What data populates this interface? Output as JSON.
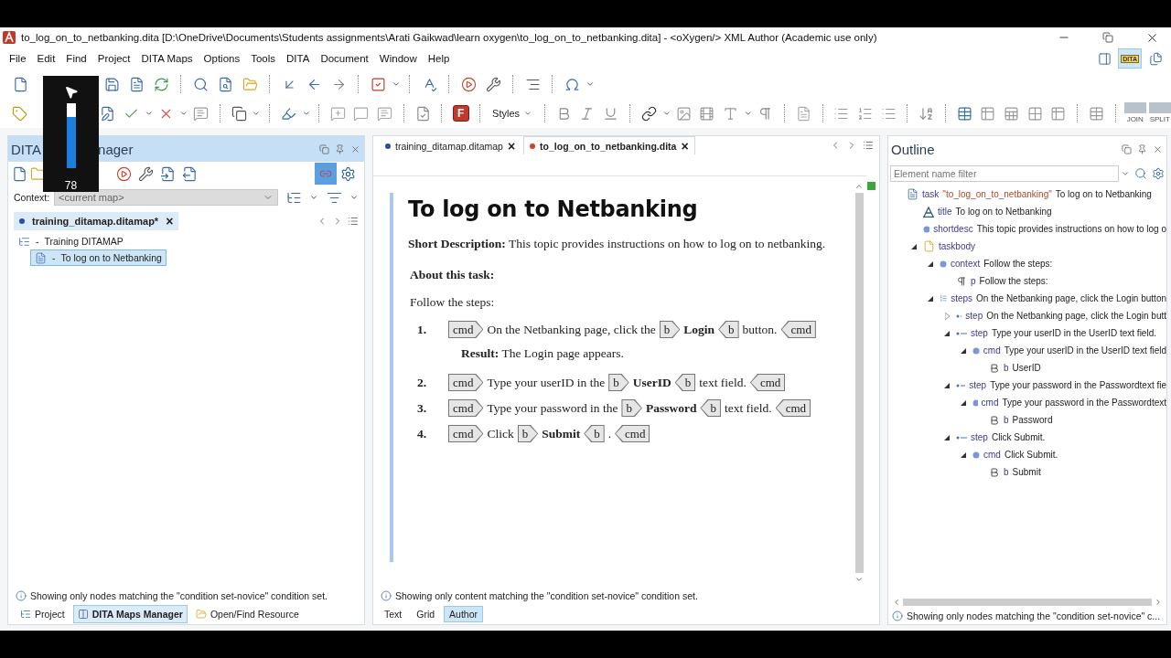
{
  "window": {
    "title": "to_log_on_to_netbanking.dita [D:\\OneDrive\\Documents\\Students assignments\\Arati Gaikwad\\learn oxygen\\to_log_on_to_netbanking.dita] - <oXygen/> XML Author (Academic use only)"
  },
  "menu": [
    "File",
    "Edit",
    "Find",
    "Project",
    "DITA Maps",
    "Options",
    "Tools",
    "DITA",
    "Document",
    "Window",
    "Help"
  ],
  "perspectives": [
    {
      "label": "DITA",
      "selected": true
    }
  ],
  "toolbar": {
    "styles": "Styles",
    "f_logo": "F",
    "table_tools": [
      "JOIN",
      "SPLIT"
    ]
  },
  "volume_overlay": {
    "reading": "78",
    "level": 0.78
  },
  "maps_manager": {
    "title_parts": [
      "DITA",
      "nager"
    ],
    "context_label": "Context:",
    "context_value": "<current map>",
    "tab": {
      "label": "training_ditamap.ditamap*",
      "close": "×"
    },
    "tree": [
      {
        "text": "Training DITAMAP",
        "dash": "-",
        "selected": false,
        "children": [
          {
            "text": "To log on to Netbanking",
            "dash": "-",
            "selected": true
          }
        ]
      }
    ],
    "info": "Showing only nodes matching the \"condition set-novice\" condition set."
  },
  "bottom_tabs": [
    {
      "label": "Project",
      "selected": false
    },
    {
      "label": "DITA Maps Manager",
      "selected": true
    },
    {
      "label": "Open/Find Resource",
      "selected": false
    }
  ],
  "editor": {
    "tabs": [
      {
        "label": "training_ditamap.ditamap",
        "close": "×",
        "selected": false,
        "color": "#2a4fa0"
      },
      {
        "label": "to_log_on_to_netbanking.dita",
        "close": "×",
        "selected": true,
        "color": "#d0402a"
      }
    ],
    "title": "To log on to Netbanking",
    "shortdesc": {
      "label": "Short Description:",
      "text": "This topic provides instructions on how to log on to netbanking."
    },
    "about": "About this task:",
    "context": "Follow the steps:",
    "steps": [
      {
        "number": "1.",
        "segments": [
          {
            "kind": "open",
            "text": "cmd"
          },
          {
            "kind": "text",
            "text": "On the Netbanking page, click the"
          },
          {
            "kind": "open",
            "text": "b"
          },
          {
            "kind": "bold",
            "text": "Login"
          },
          {
            "kind": "close",
            "text": "b"
          },
          {
            "kind": "text",
            "text": "button."
          },
          {
            "kind": "close",
            "text": "cmd"
          }
        ],
        "result": {
          "label": "Result:",
          "text": "The Login page appears."
        }
      },
      {
        "number": "2.",
        "segments": [
          {
            "kind": "open",
            "text": "cmd"
          },
          {
            "kind": "text",
            "text": "Type your userID in the"
          },
          {
            "kind": "open",
            "text": "b"
          },
          {
            "kind": "bold",
            "text": "UserID"
          },
          {
            "kind": "close",
            "text": "b"
          },
          {
            "kind": "text",
            "text": "text field."
          },
          {
            "kind": "close",
            "text": "cmd"
          }
        ]
      },
      {
        "number": "3.",
        "segments": [
          {
            "kind": "open",
            "text": "cmd"
          },
          {
            "kind": "text",
            "text": "Type your password in the"
          },
          {
            "kind": "open",
            "text": "b"
          },
          {
            "kind": "bold",
            "text": "Password"
          },
          {
            "kind": "close",
            "text": "b"
          },
          {
            "kind": "text",
            "text": "text field."
          },
          {
            "kind": "close",
            "text": "cmd"
          }
        ]
      },
      {
        "number": "4.",
        "segments": [
          {
            "kind": "open",
            "text": "cmd"
          },
          {
            "kind": "text",
            "text": "Click"
          },
          {
            "kind": "open",
            "text": "b"
          },
          {
            "kind": "bold",
            "text": "Submit"
          },
          {
            "kind": "close",
            "text": "b"
          },
          {
            "kind": "text",
            "text": "."
          },
          {
            "kind": "close",
            "text": "cmd"
          }
        ]
      }
    ],
    "info": "Showing only content matching the \"condition set-novice\" condition set.",
    "modes": [
      {
        "label": "Text",
        "selected": false
      },
      {
        "label": "Grid",
        "selected": false
      },
      {
        "label": "Author",
        "selected": true
      }
    ]
  },
  "outline": {
    "title": "Outline",
    "filter_placeholder": "Element name filter",
    "tree": [
      {
        "kind": "task",
        "tag": "task",
        "attr": "\"to_log_on_to_netbanking\"",
        "text": "To log on to Netbanking",
        "children": [
          {
            "kind": "title",
            "tag": "title",
            "text": "To log on to Netbanking"
          },
          {
            "kind": "dot",
            "tag": "shortdesc",
            "text": "This topic provides instructions on how to log o"
          },
          {
            "kind": "taskbody",
            "tag": "taskbody",
            "expanded": true,
            "children": [
              {
                "kind": "dot",
                "tag": "context",
                "text": "Follow the steps:",
                "expanded": true,
                "children": [
                  {
                    "kind": "para",
                    "tag": "p",
                    "text": "Follow the steps:"
                  }
                ]
              },
              {
                "kind": "steps",
                "tag": "steps",
                "text": "On the Netbanking page, click the Login button",
                "expanded": true,
                "children": [
                  {
                    "kind": "step",
                    "tag": "step",
                    "text": "On the Netbanking page, click the Login butt",
                    "expanded": false
                  },
                  {
                    "kind": "step",
                    "tag": "step",
                    "text": "Type your userID in the UserID text field.",
                    "expanded": true,
                    "children": [
                      {
                        "kind": "dot",
                        "tag": "cmd",
                        "text": "Type your userID in the UserID text field",
                        "expanded": true,
                        "children": [
                          {
                            "kind": "bold",
                            "tag": "b",
                            "text": "UserID"
                          }
                        ]
                      }
                    ]
                  },
                  {
                    "kind": "step",
                    "tag": "step",
                    "text": "Type your password in the Passwordtext fie",
                    "expanded": true,
                    "children": [
                      {
                        "kind": "dot",
                        "tag": "cmd",
                        "text": "Type your password in the Passwordtext",
                        "expanded": true,
                        "children": [
                          {
                            "kind": "bold",
                            "tag": "b",
                            "text": "Password"
                          }
                        ]
                      }
                    ]
                  },
                  {
                    "kind": "step",
                    "tag": "step",
                    "text": "Click Submit.",
                    "expanded": true,
                    "children": [
                      {
                        "kind": "dot",
                        "tag": "cmd",
                        "text": "Click Submit.",
                        "expanded": true,
                        "children": [
                          {
                            "kind": "bold",
                            "tag": "b",
                            "text": "Submit"
                          }
                        ]
                      }
                    ]
                  }
                ]
              }
            ]
          }
        ]
      }
    ],
    "info": "Showing only nodes matching the \"condition set-novice\" c..."
  }
}
